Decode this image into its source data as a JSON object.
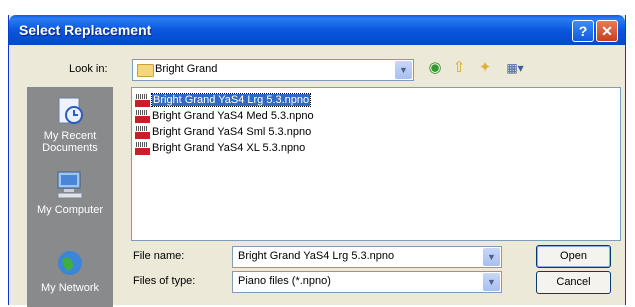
{
  "dialog": {
    "title": "Select Replacement",
    "help_glyph": "?",
    "close_glyph": "✕"
  },
  "look_in": {
    "label": "Look in:",
    "value": "Bright Grand"
  },
  "toolbar": {
    "icons": [
      "back-icon",
      "up-folder-icon",
      "new-folder-icon",
      "views-menu-icon"
    ]
  },
  "places": [
    {
      "label": "My Recent Documents"
    },
    {
      "label": "My Computer"
    },
    {
      "label": "My Network"
    }
  ],
  "files": [
    {
      "name": "Bright Grand YaS4  Lrg 5.3.npno",
      "selected": true
    },
    {
      "name": "Bright Grand YaS4  Med 5.3.npno",
      "selected": false
    },
    {
      "name": "Bright Grand YaS4  Sml 5.3.npno",
      "selected": false
    },
    {
      "name": "Bright Grand YaS4  XL 5.3.npno",
      "selected": false
    }
  ],
  "file_name": {
    "label": "File name:",
    "value": "Bright Grand YaS4  Lrg 5.3.npno"
  },
  "file_type": {
    "label": "Files of type:",
    "value": "Piano files (*.npno)"
  },
  "buttons": {
    "open": "Open",
    "cancel": "Cancel"
  },
  "colors": {
    "title_bar": "#0b57de",
    "selection": "#316ac5",
    "dialog_bg": "#ece9d8"
  }
}
